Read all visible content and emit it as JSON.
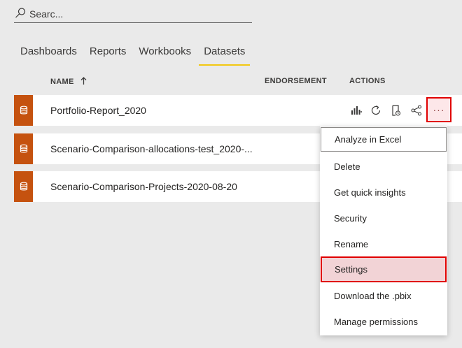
{
  "search": {
    "placeholder": "Searc..."
  },
  "tabs": [
    "Dashboards",
    "Reports",
    "Workbooks",
    "Datasets"
  ],
  "active_tab": "Datasets",
  "table": {
    "headers": {
      "name": "NAME",
      "endorsement": "ENDORSEMENT",
      "actions": "ACTIONS"
    },
    "sort_direction": "ascending",
    "rows": [
      {
        "name": "Portfolio-Report_2020"
      },
      {
        "name": "Scenario-Comparison-allocations-test_2020-..."
      },
      {
        "name": "Scenario-Comparison-Projects-2020-08-20"
      }
    ]
  },
  "row_actions": {
    "icons": [
      "create-report-icon",
      "refresh-icon",
      "schedule-refresh-icon",
      "share-icon"
    ],
    "more_label": "···"
  },
  "context_menu": {
    "items": [
      "Analyze in Excel",
      "Delete",
      "Get quick insights",
      "Security",
      "Rename",
      "Settings",
      "Download the .pbix",
      "Manage permissions"
    ],
    "highlighted": "Settings"
  },
  "colors": {
    "background": "#eaeaea",
    "dataset_icon_bg": "#c5520f",
    "active_tab_underline": "#f2c811",
    "highlight_border": "#e00000",
    "highlight_fill": "#f2d3d6"
  }
}
